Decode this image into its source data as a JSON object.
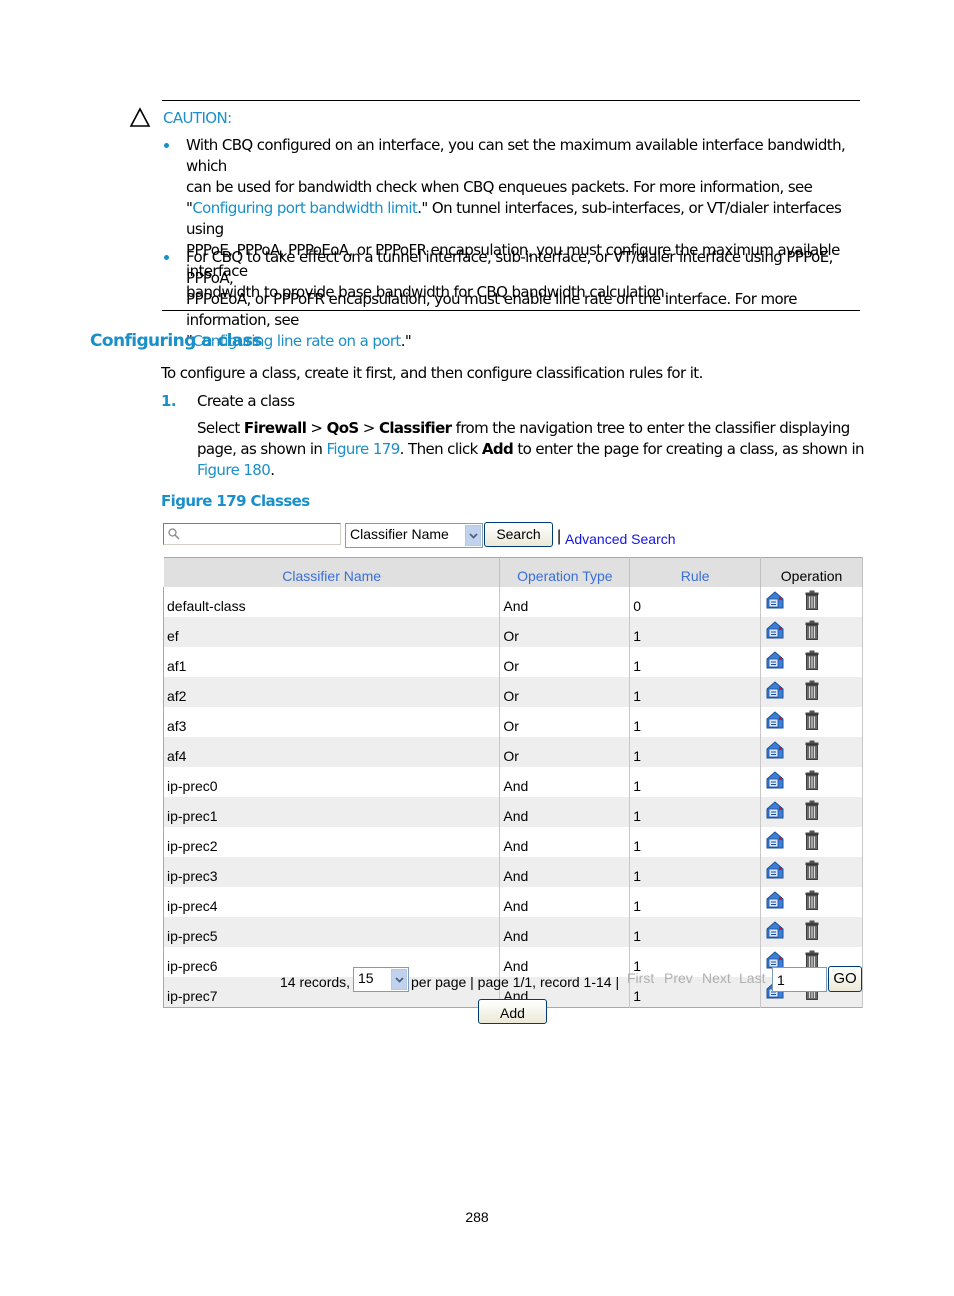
{
  "caution": {
    "label": "CAUTION:",
    "bullets": [
      {
        "lines": [
          "With CBQ configured on an interface, you can set the maximum available interface bandwidth, which",
          "can be used for bandwidth check when CBQ enqueues packets. For more information, see"
        ],
        "link_prefix": "\"",
        "link": "Configuring port bandwidth limit",
        "link_suffix": ".\" On tunnel interfaces, sub-interfaces, or VT/dialer interfaces using",
        "lines_after": [
          "PPPoE, PPPoA, PPPoEoA, or PPPoFR encapsulation, you must configure the maximum available interface",
          "bandwidth to provide base bandwidth for CBQ bandwidth calculation."
        ]
      },
      {
        "lines": [
          "For CBQ to take effect on a tunnel interface, sub-interface, or VT/dialer interface using PPPoE, PPPoA,",
          "PPPoEoA, or PPPoFR encapsulation, you must enable line rate on the interface. For more information, see"
        ],
        "link_prefix": "\"",
        "link": "Configuring line rate on a port",
        "link_suffix": ".\""
      }
    ]
  },
  "section": {
    "heading": "Configuring a class",
    "intro": "To configure a class, create it first, and then configure classification rules for it.",
    "step": {
      "number": "1.",
      "title": "Create a class",
      "body": {
        "t1": "Select ",
        "b1": "Firewall",
        "t2": " > ",
        "b2": "QoS",
        "t3": " > ",
        "b3": "Classifier",
        "t4": " from the navigation tree to enter the classifier displaying page, as shown in ",
        "l1": "Figure 179",
        "t5": ". Then click ",
        "b4": "Add",
        "t6": " to enter the page for creating a class, as shown in ",
        "l2": "Figure 180",
        "t7": "."
      }
    },
    "figure_caption": "Figure 179 Classes"
  },
  "ui": {
    "search": {
      "value": "",
      "field_select": "Classifier Name",
      "search_button": "Search",
      "separator": "|",
      "advanced_link": "Advanced Search"
    },
    "table": {
      "headers": [
        "Classifier Name",
        "Operation Type",
        "Rule",
        "Operation"
      ],
      "rows": [
        {
          "name": "default-class",
          "type": "And",
          "rule": "0"
        },
        {
          "name": "ef",
          "type": "Or",
          "rule": "1"
        },
        {
          "name": "af1",
          "type": "Or",
          "rule": "1"
        },
        {
          "name": "af2",
          "type": "Or",
          "rule": "1"
        },
        {
          "name": "af3",
          "type": "Or",
          "rule": "1"
        },
        {
          "name": "af4",
          "type": "Or",
          "rule": "1"
        },
        {
          "name": "ip-prec0",
          "type": "And",
          "rule": "1"
        },
        {
          "name": "ip-prec1",
          "type": "And",
          "rule": "1"
        },
        {
          "name": "ip-prec2",
          "type": "And",
          "rule": "1"
        },
        {
          "name": "ip-prec3",
          "type": "And",
          "rule": "1"
        },
        {
          "name": "ip-prec4",
          "type": "And",
          "rule": "1"
        },
        {
          "name": "ip-prec5",
          "type": "And",
          "rule": "1"
        },
        {
          "name": "ip-prec6",
          "type": "And",
          "rule": "1"
        },
        {
          "name": "ip-prec7",
          "type": "And",
          "rule": "1"
        }
      ],
      "row_icons": [
        "edit-details-icon",
        "trash-icon"
      ]
    },
    "pager": {
      "records": "14 records,",
      "per_page_value": "15",
      "per_page_text": "per page | page 1/1, record 1-14 |",
      "first": "First",
      "prev": "Prev",
      "next": "Next",
      "last": "Last",
      "page_input": "1",
      "go": "GO"
    },
    "add_button": "Add"
  },
  "page_number": "288",
  "colors": {
    "accent": "#1a8fc9",
    "header_link": "#3a6fd8",
    "advanced_link": "#1515e0"
  }
}
